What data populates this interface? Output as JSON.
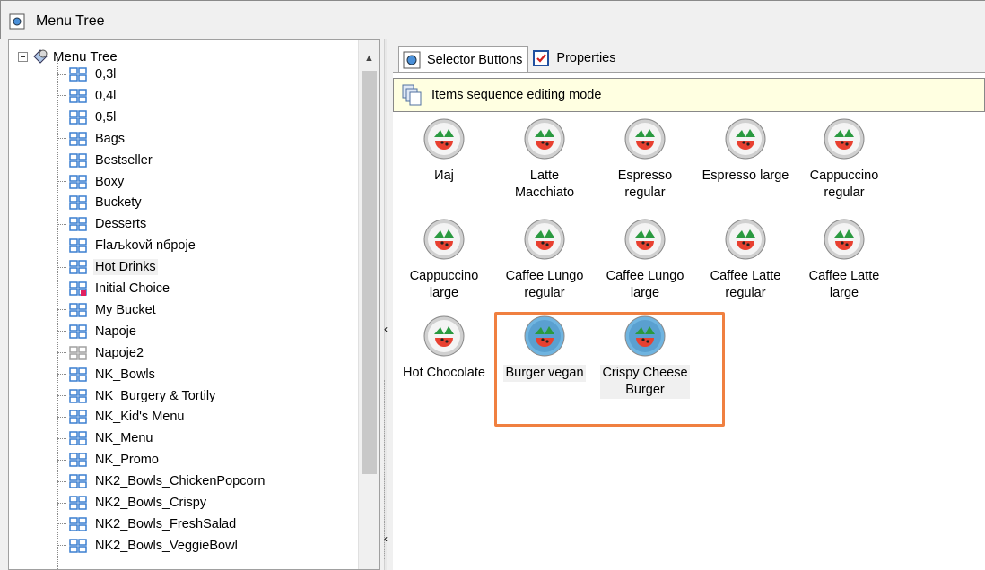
{
  "window": {
    "title": "Menu Tree"
  },
  "tree": {
    "root_label": "Menu Tree",
    "items": [
      {
        "label": "0,3l"
      },
      {
        "label": "0,4l"
      },
      {
        "label": "0,5l"
      },
      {
        "label": "Bags"
      },
      {
        "label": "Bestseller"
      },
      {
        "label": "Boxy"
      },
      {
        "label": "Buckety"
      },
      {
        "label": "Desserts"
      },
      {
        "label": "Flaљkovй nбpoje"
      },
      {
        "label": "Hot Drinks"
      },
      {
        "label": "Initial Choice"
      },
      {
        "label": "My Bucket"
      },
      {
        "label": "Napoje"
      },
      {
        "label": "Napoje2"
      },
      {
        "label": "NK_Bowls"
      },
      {
        "label": "NK_Burgery & Tortily"
      },
      {
        "label": "NK_Kid's Menu"
      },
      {
        "label": "NK_Menu"
      },
      {
        "label": "NK_Promo"
      },
      {
        "label": "NK2_Bowls_ChickenPopcorn"
      },
      {
        "label": "NK2_Bowls_Crispy"
      },
      {
        "label": "NK2_Bowls_FreshSalad"
      },
      {
        "label": "NK2_Bowls_VeggieBowl"
      }
    ],
    "selected_index": 9
  },
  "tabs": [
    {
      "label": "Selector Buttons"
    },
    {
      "label": "Properties"
    }
  ],
  "notice": {
    "text": "Items sequence editing mode"
  },
  "buttons": [
    {
      "label": "Иaj"
    },
    {
      "label": "Latte\nMacchiato"
    },
    {
      "label": "Espresso\nregular"
    },
    {
      "label": "Espresso large"
    },
    {
      "label": "Cappuccino\nregular"
    },
    {
      "label": "Cappuccino\nlarge"
    },
    {
      "label": "Caffee Lungo\nregular"
    },
    {
      "label": "Caffee Lungo\nlarge"
    },
    {
      "label": "Caffee Latte\nregular"
    },
    {
      "label": "Caffee Latte\nlarge"
    },
    {
      "label": "Hot Chocolate"
    },
    {
      "label": "Burger vegan"
    },
    {
      "label": "Crispy Cheese\nBurger"
    }
  ],
  "colors": {
    "highlight": "#f08040",
    "notice_bg": "#ffffe1",
    "ball_normal": "#d0d0d0",
    "ball_selected": "#6fb4e0",
    "grid_icon": "#3a7fd0"
  }
}
